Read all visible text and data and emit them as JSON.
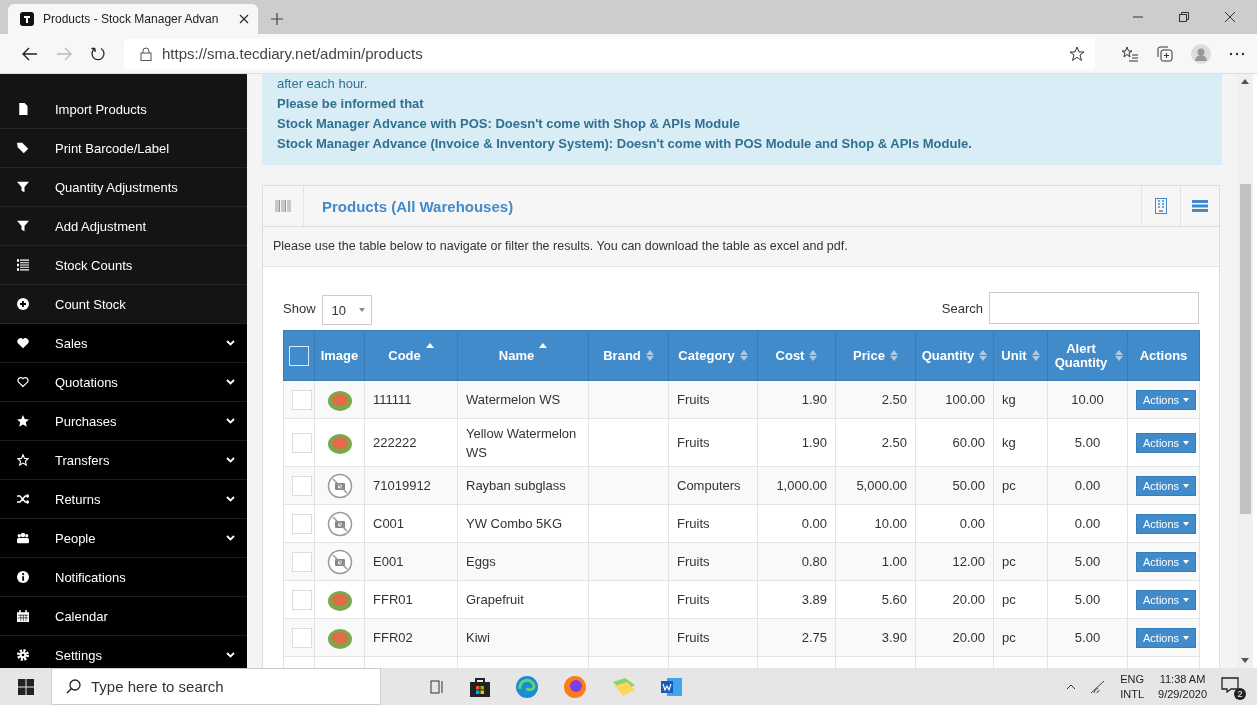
{
  "browser": {
    "tab_title": "Products - Stock Manager Advan",
    "url": "https://sma.tecdiary.net/admin/products"
  },
  "sidebar": {
    "items": [
      {
        "label": "Import Products",
        "nested": true,
        "has_submenu": false
      },
      {
        "label": "Print Barcode/Label",
        "nested": true,
        "has_submenu": false
      },
      {
        "label": "Quantity Adjustments",
        "nested": true,
        "has_submenu": false
      },
      {
        "label": "Add Adjustment",
        "nested": true,
        "has_submenu": false
      },
      {
        "label": "Stock Counts",
        "nested": true,
        "has_submenu": false
      },
      {
        "label": "Count Stock",
        "nested": true,
        "has_submenu": false
      },
      {
        "label": "Sales",
        "nested": false,
        "has_submenu": true
      },
      {
        "label": "Quotations",
        "nested": false,
        "has_submenu": true
      },
      {
        "label": "Purchases",
        "nested": false,
        "has_submenu": true
      },
      {
        "label": "Transfers",
        "nested": false,
        "has_submenu": true
      },
      {
        "label": "Returns",
        "nested": false,
        "has_submenu": true
      },
      {
        "label": "People",
        "nested": false,
        "has_submenu": true
      },
      {
        "label": "Notifications",
        "nested": false,
        "has_submenu": false
      },
      {
        "label": "Calendar",
        "nested": false,
        "has_submenu": false
      },
      {
        "label": "Settings",
        "nested": false,
        "has_submenu": true
      }
    ]
  },
  "notice": {
    "lines": [
      {
        "text": "after each hour.",
        "bold": false
      },
      {
        "text": "Please be informed that",
        "bold": true
      },
      {
        "text": "Stock Manager Advance with POS: Doesn't come with Shop & APIs Module",
        "bold": true
      },
      {
        "text": "Stock Manager Advance (Invoice & Inventory System): Doesn't come with POS Module and Shop & APIs Module.",
        "bold": true
      }
    ]
  },
  "panel": {
    "title": "Products (All Warehouses)",
    "description": "Please use the table below to navigate or filter the results. You can download the table as excel and pdf.",
    "show_label": "Show",
    "page_size": "10",
    "search_label": "Search"
  },
  "table": {
    "header_checked": false,
    "columns": [
      {
        "label": "Image",
        "sortable": false
      },
      {
        "label": "Code",
        "sortable": true,
        "sorted_asc": true
      },
      {
        "label": "Name",
        "sortable": true,
        "sorted_asc": true
      },
      {
        "label": "Brand",
        "sortable": true,
        "sorted_asc": false
      },
      {
        "label": "Category",
        "sortable": true,
        "sorted_asc": false
      },
      {
        "label": "Cost",
        "sortable": true,
        "sorted_asc": false
      },
      {
        "label": "Price",
        "sortable": true,
        "sorted_asc": false
      },
      {
        "label": "Quantity",
        "sortable": true,
        "sorted_asc": false
      },
      {
        "label": "Unit",
        "sortable": true,
        "sorted_asc": false
      },
      {
        "label": "Alert Quantity",
        "sortable": true,
        "sorted_asc": false
      },
      {
        "label": "Actions",
        "sortable": false
      }
    ],
    "rows": [
      {
        "checked": false,
        "has_image": true,
        "code": "111111",
        "name": "Watermelon WS",
        "category": "Fruits",
        "cost": "1.90",
        "price": "2.50",
        "quantity": "100.00",
        "unit": "kg",
        "alert_quantity": "10.00",
        "action": "Actions"
      },
      {
        "checked": false,
        "has_image": true,
        "code": "222222",
        "name": "Yellow Watermelon WS",
        "category": "Fruits",
        "cost": "1.90",
        "price": "2.50",
        "quantity": "60.00",
        "unit": "kg",
        "alert_quantity": "5.00",
        "action": "Actions"
      },
      {
        "checked": false,
        "has_image": false,
        "code": "71019912",
        "name": "Rayban subglass",
        "category": "Computers",
        "cost": "1,000.00",
        "price": "5,000.00",
        "quantity": "50.00",
        "unit": "pc",
        "alert_quantity": "0.00",
        "action": "Actions"
      },
      {
        "checked": false,
        "has_image": false,
        "code": "C001",
        "name": "YW Combo 5KG",
        "category": "Fruits",
        "cost": "0.00",
        "price": "10.00",
        "quantity": "0.00",
        "alert_quantity": "0.00",
        "action": "Actions"
      },
      {
        "checked": false,
        "has_image": false,
        "code": "E001",
        "name": "Eggs",
        "category": "Fruits",
        "cost": "0.80",
        "price": "1.00",
        "quantity": "12.00",
        "unit": "pc",
        "alert_quantity": "5.00",
        "action": "Actions"
      },
      {
        "checked": false,
        "has_image": true,
        "code": "FFR01",
        "name": "Grapefruit",
        "category": "Fruits",
        "cost": "3.89",
        "price": "5.60",
        "quantity": "20.00",
        "unit": "pc",
        "alert_quantity": "5.00",
        "action": "Actions"
      },
      {
        "checked": false,
        "has_image": true,
        "code": "FFR02",
        "name": "Kiwi",
        "category": "Fruits",
        "cost": "2.75",
        "price": "3.90",
        "quantity": "20.00",
        "unit": "pc",
        "alert_quantity": "5.00",
        "action": "Actions"
      }
    ]
  },
  "taskbar": {
    "search_placeholder": "Type here to search",
    "language": "ENG",
    "layout": "INTL",
    "time": "11:38 AM",
    "date": "9/29/2020",
    "notification_count": "2"
  }
}
